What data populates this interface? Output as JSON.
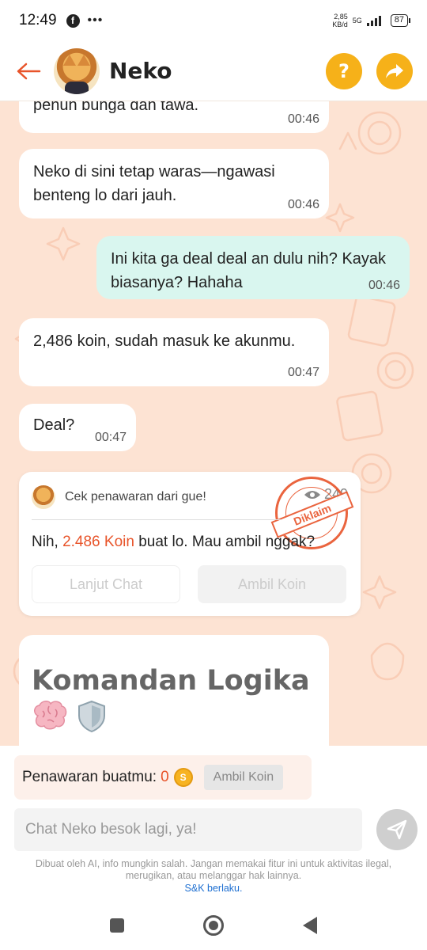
{
  "status_bar": {
    "time": "12:49",
    "dots": "•••",
    "speed_value": "2,85",
    "speed_unit": "KB/d",
    "network": "5G",
    "battery": "87"
  },
  "header": {
    "name": "Neko",
    "help_label": "?",
    "accent_color": "#f6b119",
    "back_color": "#e8542a"
  },
  "messages": [
    {
      "text": "penuh bunga dan tawa.",
      "time": "00:46",
      "from": "bot"
    },
    {
      "text": "Neko di sini tetap waras—ngawasi benteng lo dari jauh.",
      "time": "00:46",
      "from": "bot"
    },
    {
      "text": "Ini kita ga deal deal an dulu nih? Kayak biasanya? Hahaha",
      "time": "00:46",
      "from": "user"
    },
    {
      "text": "2,486 koin, sudah masuk ke akunmu.",
      "time": "00:47",
      "from": "bot"
    },
    {
      "text": "Deal?",
      "time": "00:47",
      "from": "bot"
    }
  ],
  "offer_card": {
    "header": "Cek penawaran dari gue!",
    "count": "249",
    "stamp_text": "Diklaim",
    "msg_prefix": "Nih, ",
    "msg_amount": "2.486 Koin",
    "msg_suffix": " buat lo. Mau ambil nggak?",
    "btn_continue": "Lanjut Chat",
    "btn_take": "Ambil Koin"
  },
  "big_message": {
    "title": "Komandan Logika",
    "emojis": [
      "brain-emoji",
      "shield-emoji"
    ]
  },
  "offer_bar": {
    "label": "Penawaran buatmu:",
    "value": "0",
    "coin_symbol": "S",
    "button": "Ambil Koin"
  },
  "input": {
    "placeholder": "Chat Neko besok lagi, ya!"
  },
  "disclaimer": {
    "text": "Dibuat oleh AI, info mungkin salah. Jangan memakai fitur ini untuk aktivitas ilegal, merugikan, atau melanggar hak lainnya.",
    "link": "S&K berlaku."
  }
}
